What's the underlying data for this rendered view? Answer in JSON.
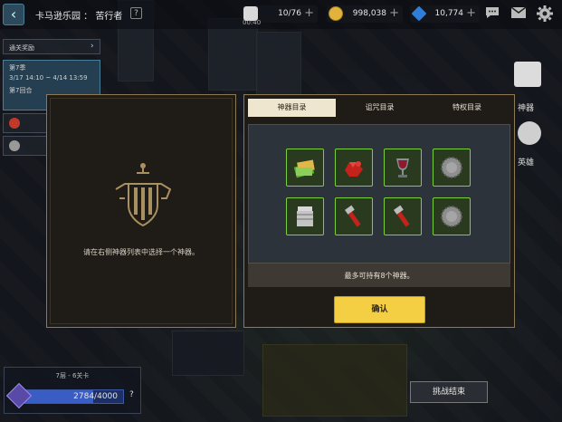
{
  "topbar": {
    "back_icon": "back-arrow-icon",
    "title": "卡马逊乐园 ： 苦行者",
    "help": "?",
    "stamina": {
      "value": "10/76",
      "plus": "+",
      "timer": "00:40"
    },
    "gold": {
      "value": "998,038",
      "plus": "+"
    },
    "gems": {
      "value": "10,774",
      "plus": "+"
    },
    "icons": [
      "chat-icon",
      "mail-icon",
      "settings-icon"
    ]
  },
  "left_info": {
    "reward_label": "通关奖励",
    "season_label": "第7季",
    "date_range": "3/17 14:10 ~ 4/14 13:59",
    "round_label": "第7回合"
  },
  "sidebar": {
    "artifact_label": "神器",
    "hero_label": "英雄"
  },
  "modal": {
    "hint": "请在右侧神器列表中选择一个神器。",
    "tabs": [
      {
        "label": "神器目录",
        "active": true
      },
      {
        "label": "诅咒目录",
        "active": false
      },
      {
        "label": "特权目录",
        "active": false
      }
    ],
    "artifacts": [
      {
        "icon": "cash-bundle-icon"
      },
      {
        "icon": "red-gem-pile-icon"
      },
      {
        "icon": "goblet-icon"
      },
      {
        "icon": "stone-coin-icon"
      },
      {
        "icon": "silver-jar-icon"
      },
      {
        "icon": "pipe-wrench-icon"
      },
      {
        "icon": "pipe-wrench-icon"
      },
      {
        "icon": "stone-coin-icon"
      }
    ],
    "capacity_text": "最多可持有8个神器。",
    "confirm_label": "确认"
  },
  "bottom": {
    "floor_label": "7层 - 6关卡",
    "progress_text": "2784/4000",
    "progress_fraction": 0.696,
    "help": "?",
    "battle_end_label": "挑战结束"
  }
}
